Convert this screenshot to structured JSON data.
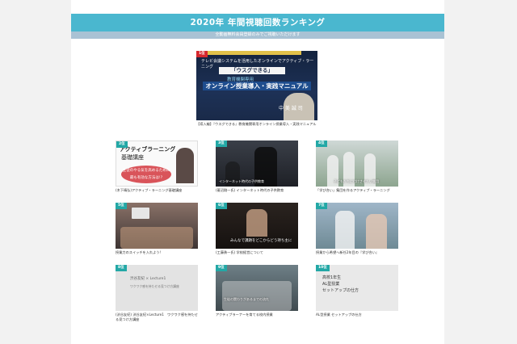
{
  "banner": {
    "title": "2020年 年間視聴回数ランキング",
    "subtitle": "全動画無料会員登録のみでご視聴いただけます"
  },
  "featured": {
    "rank": "1位",
    "line1": "テレビ会議システムを活用したオンラインでアクティブ・ラーニング",
    "box": "「ウスグできる」",
    "line2": "教育機関専用",
    "line3": "オンライン授業導入・実践マニュアル",
    "name": "中 美 誠 司",
    "caption": "【導入編】『ウスグできる』教育機関専用オンライン授業導入・実践マニュアル"
  },
  "cards": [
    {
      "rank": "2位",
      "caption": "(木下晴弘)アクティブ・ラーニング基礎講座",
      "t1": "アクティブラーニング",
      "t2": "基礎講座",
      "oval": "生徒のやる気を高めるために最も有効な方法は!?"
    },
    {
      "rank": "3位",
      "caption": "(菱沼剛一氏) インターネット時代の子供教育",
      "sub": "インターネット時代の子供教育"
    },
    {
      "rank": "4位",
      "caption": "「学び合い」集団を作るアクティブ・ラーニング",
      "sub": "子どもたちに付けさせたい集団"
    },
    {
      "rank": "5位",
      "caption": "授業力のスイッチを入れよう!"
    },
    {
      "rank": "6位",
      "caption": "(工藤勇一氏) 学校経営について",
      "sub": "みんなで課題をどこからどう持ち主に"
    },
    {
      "rank": "7位",
      "caption": "授業から希望へ新任2年目の『学び合い』"
    },
    {
      "rank": "8位",
      "caption": "(渋谷友紀) 渋谷友紀×Lecture1　ワクワク感を持たせる見つけ方講座",
      "txt": "渋谷友紀 × Lecture1",
      "txt2": "ワクワク感を持たせる見つけ方講座"
    },
    {
      "rank": "9位",
      "caption": "アクティブラーナーを育てる校内授業",
      "sub": "生徒の関わりがあるまでの流れ"
    },
    {
      "rank": "10位",
      "caption": "AL型授業 セットアップの仕方",
      "txt": "高校1年生\nAL型授業\nセットアップの仕方"
    }
  ],
  "colors": {
    "banner": "#4ab7cf",
    "subbar": "#a9c2d4",
    "rank_first": "#d6282e",
    "rank": "#23a8a6"
  }
}
